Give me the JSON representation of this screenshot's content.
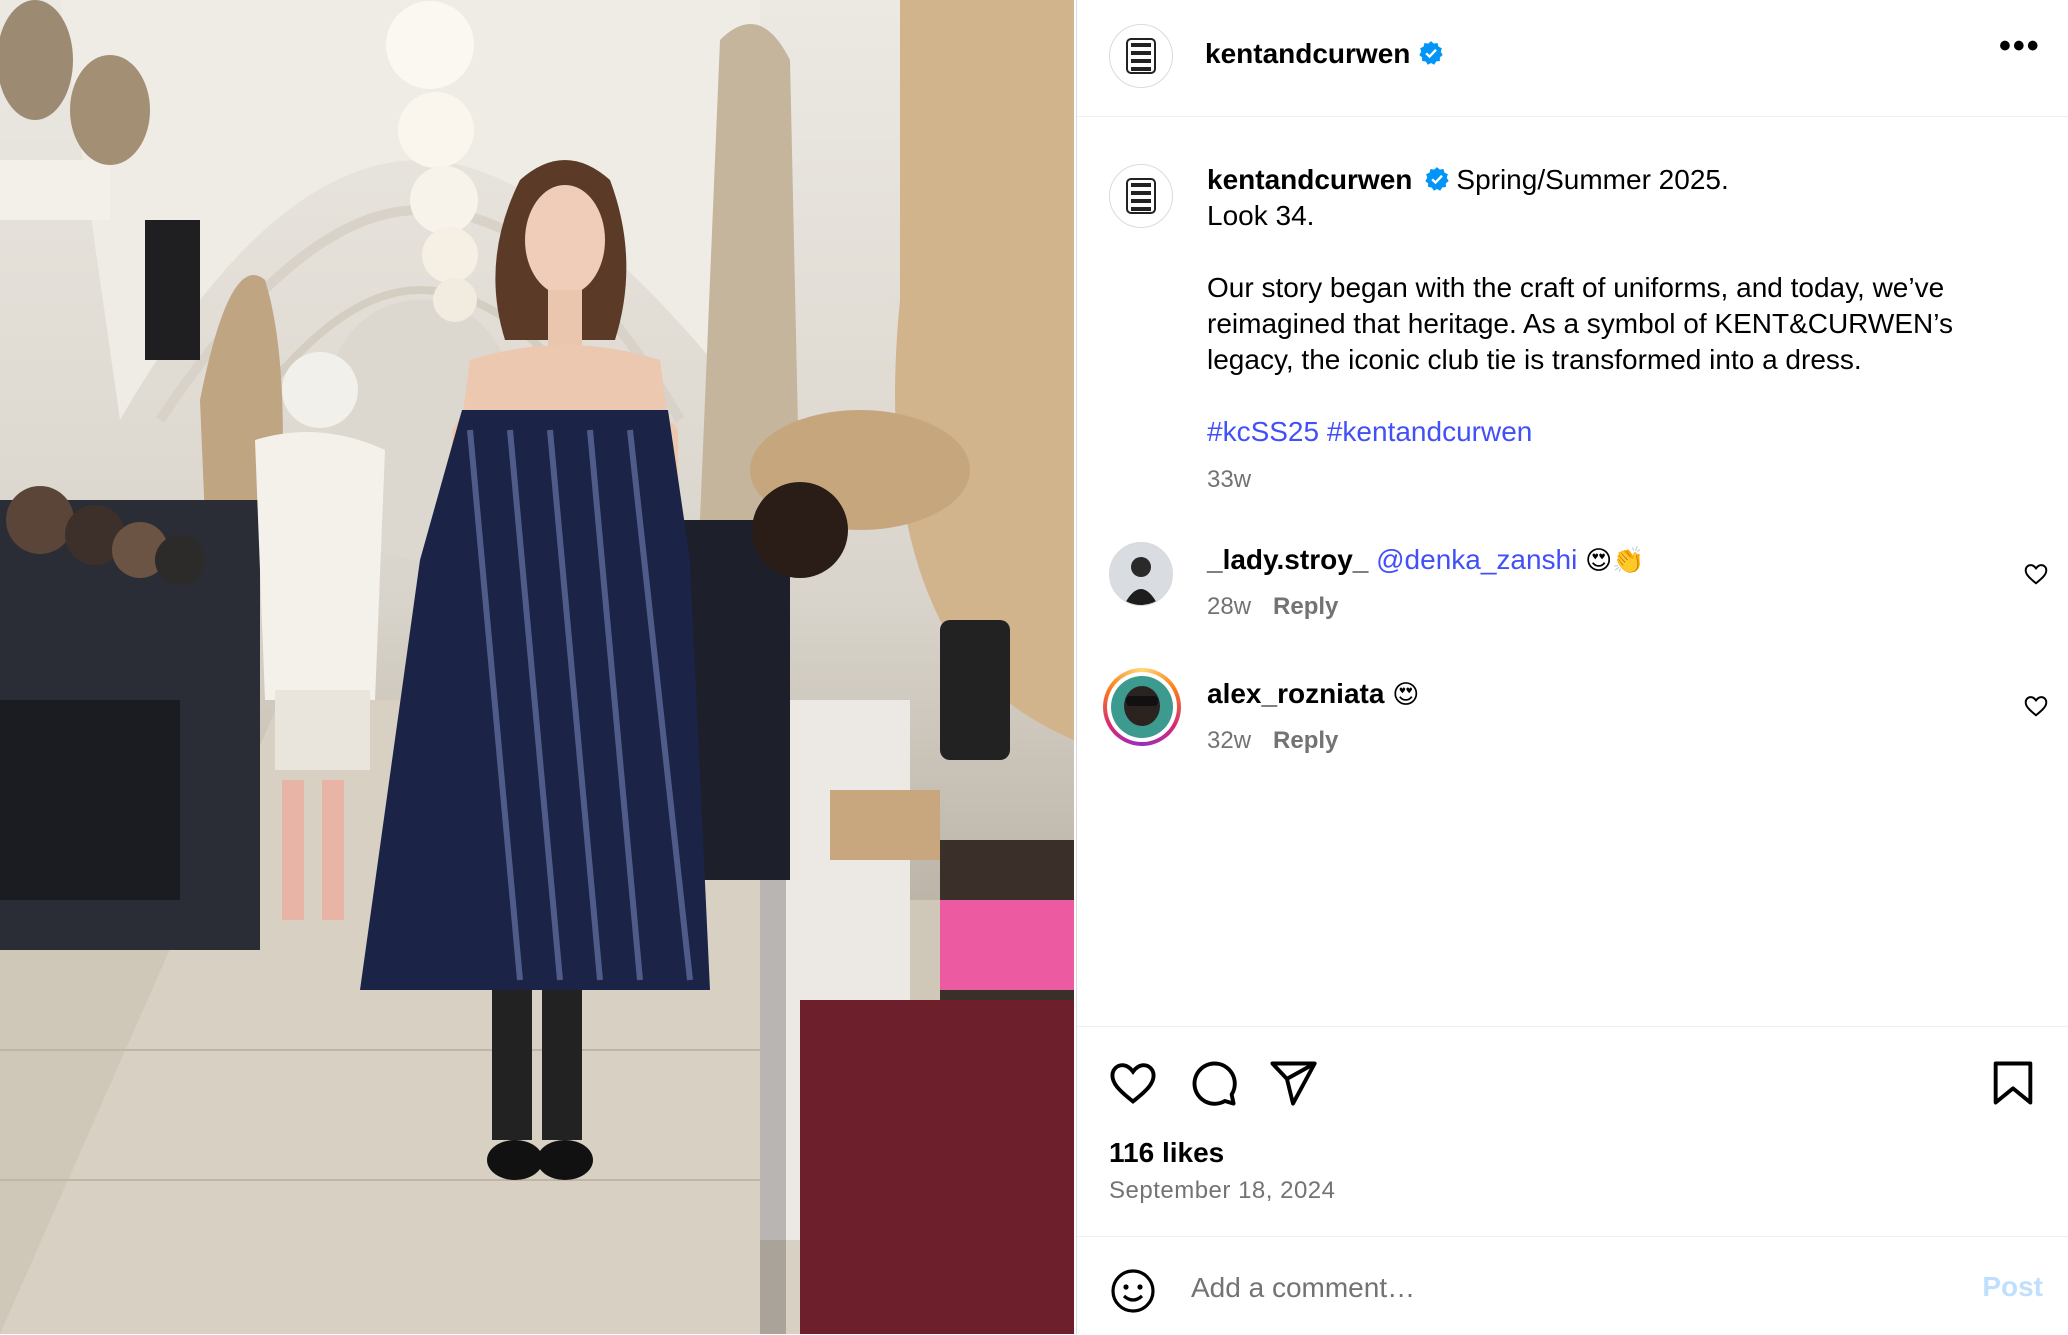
{
  "post": {
    "username": "kentandcurwen",
    "verified": true,
    "more_icon": "more-horizontal-icon"
  },
  "caption": {
    "username": "kentandcurwen",
    "line1": "Spring/Summer 2025.",
    "line2": "Look 34.",
    "paragraph": "Our story began with the craft of uniforms, and today, we’ve reimagined that heritage. As a symbol of KENT&CURWEN’s legacy, the iconic club tie is transformed into a dress.",
    "hashtags": [
      "#kcSS25",
      "#kentandcurwen"
    ],
    "age": "33w"
  },
  "comments": [
    {
      "username": "_lady.stroy_",
      "mention": "@denka_zanshi",
      "emoji": "😍👏",
      "age": "28w",
      "reply": "Reply"
    },
    {
      "username": "alex_rozniata",
      "mention": "",
      "emoji": "😍",
      "age": "32w",
      "reply": "Reply"
    }
  ],
  "actions": {
    "likes": "116 likes",
    "date": "September 18, 2024"
  },
  "composer": {
    "placeholder": "Add a comment…",
    "post_label": "Post"
  },
  "colors": {
    "link": "#4150f7",
    "meta": "#737373",
    "verified": "#0095f6",
    "post_disabled": "#c0dffd"
  }
}
